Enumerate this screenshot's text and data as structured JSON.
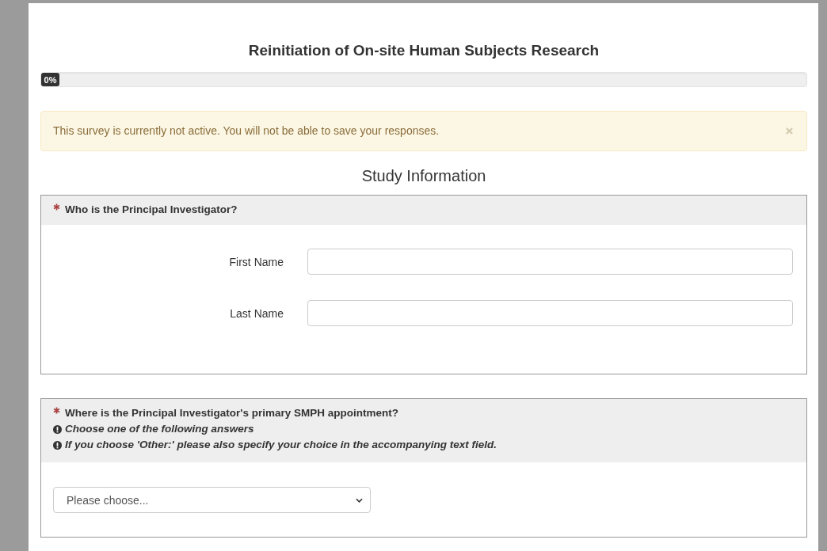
{
  "survey": {
    "title": "Reinitiation of On-site Human Subjects Research",
    "progress": {
      "level": 0,
      "label": "0%"
    }
  },
  "alert": {
    "message": "This survey is currently not active. You will not be able to save your responses.",
    "dismissible": true
  },
  "section": {
    "title": "Study Information"
  },
  "questions": [
    {
      "kind": "text_fields",
      "required": true,
      "text": "Who is the Principal Investigator?",
      "fields": [
        {
          "label": "First Name"
        },
        {
          "label": "Last Name"
        }
      ]
    },
    {
      "kind": "dropdown",
      "required": true,
      "text": "Where is the Principal Investigator's primary SMPH appointment?",
      "notes": [
        "Choose one of the following answers",
        "If you choose 'Other:' please also specify your choice in the accompanying text field."
      ],
      "selected_option": "Please choose..."
    }
  ]
}
